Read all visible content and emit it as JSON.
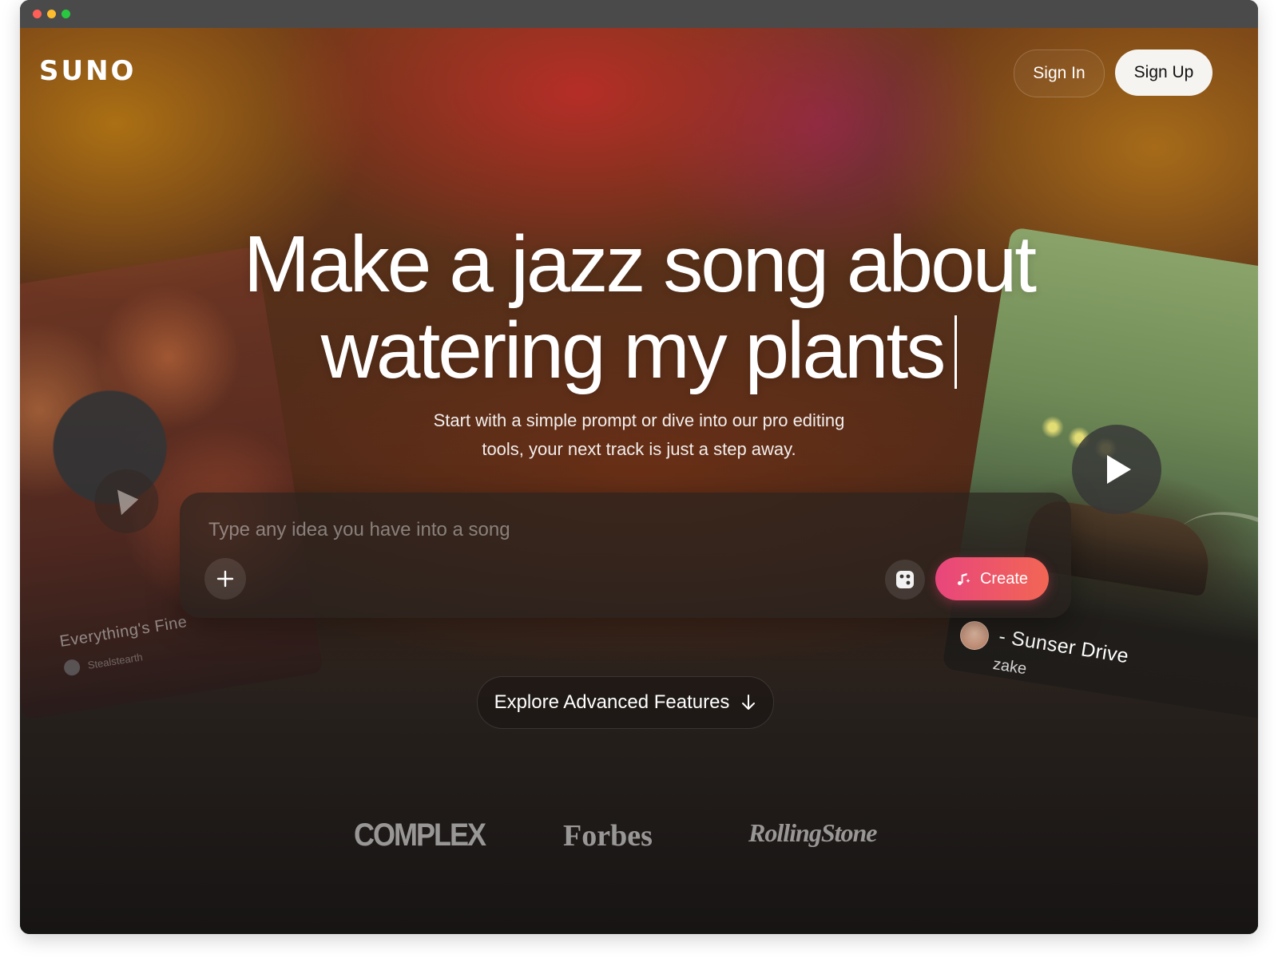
{
  "header": {
    "logo": "SUNO",
    "sign_in_label": "Sign In",
    "sign_up_label": "Sign Up"
  },
  "hero": {
    "headline_line1": "Make a jazz song about",
    "headline_line2": "watering my plants",
    "subtitle_line1": "Start with a simple prompt or dive into our pro editing",
    "subtitle_line2": "tools, your next track is just a step away."
  },
  "prompt": {
    "placeholder": "Type any idea you have into a song",
    "value": "",
    "add_icon": "plus-icon",
    "dice_icon": "dice-icon",
    "create_label": "Create",
    "create_icon": "music-note-sparkle-icon",
    "create_gradient": [
      "#e8467c",
      "#f26654"
    ]
  },
  "cards": {
    "left": {
      "title": "Everything's Fine",
      "artist": "Stealstearth",
      "icon": "play-icon"
    },
    "right": {
      "title": "- Sunser Drive",
      "artist": "zake",
      "icon": "play-icon"
    }
  },
  "explore": {
    "label": "Explore Advanced Features",
    "icon": "arrow-down-icon"
  },
  "press": {
    "logos": [
      "COMPLEX",
      "Forbes",
      "RollingStone"
    ]
  },
  "colors": {
    "accent_pink": "#e8467c",
    "accent_orange": "#f26654",
    "background_dark": "#171414"
  }
}
